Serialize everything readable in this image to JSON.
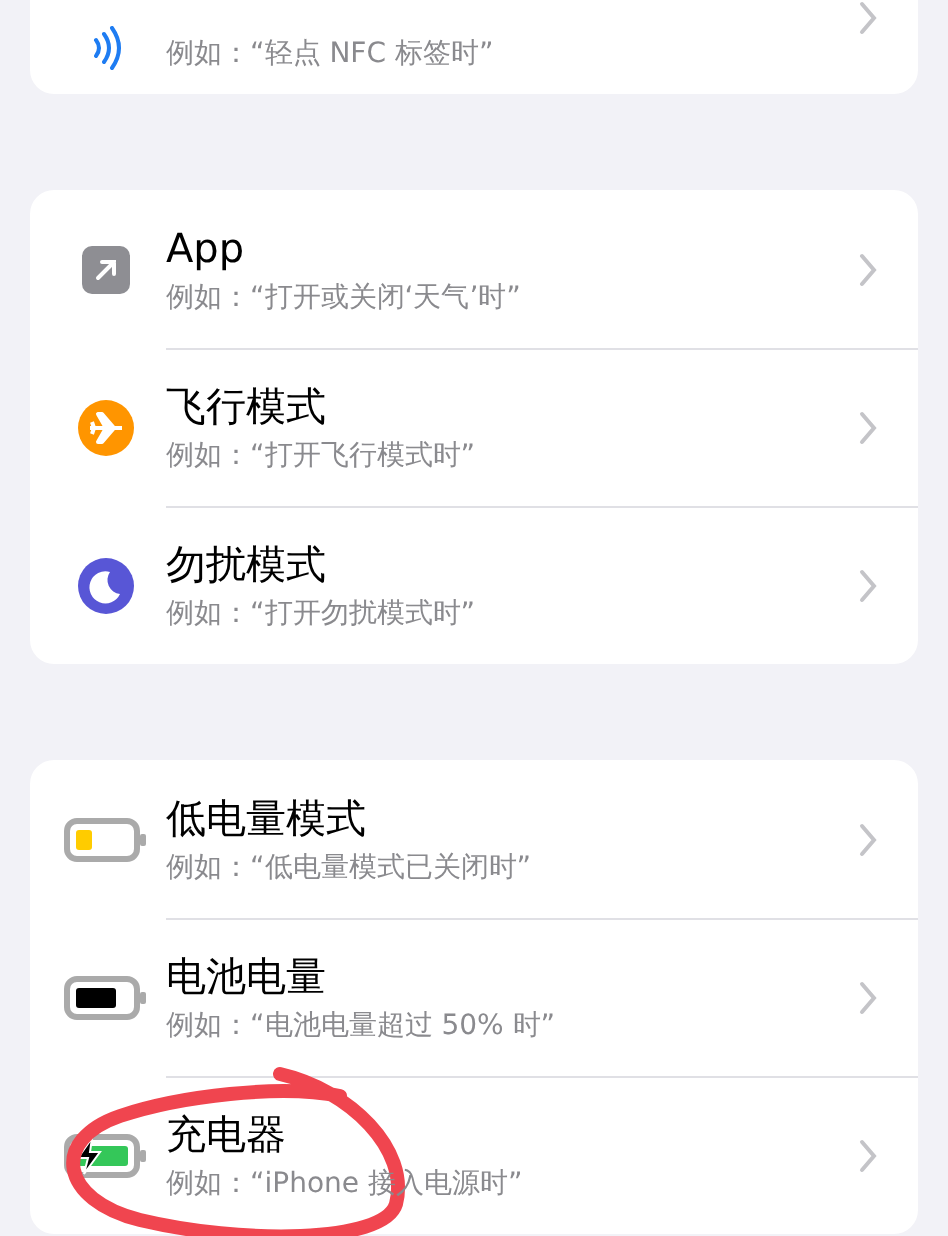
{
  "groups": [
    {
      "items": [
        {
          "subtitle": "例如：“轻点 NFC 标签时”"
        }
      ]
    },
    {
      "items": [
        {
          "title": "App",
          "subtitle": "例如：“打开或关闭‘天气’时”"
        },
        {
          "title": "飞行模式",
          "subtitle": "例如：“打开飞行模式时”"
        },
        {
          "title": "勿扰模式",
          "subtitle": "例如：“打开勿扰模式时”"
        }
      ]
    },
    {
      "items": [
        {
          "title": "低电量模式",
          "subtitle": "例如：“低电量模式已关闭时”"
        },
        {
          "title": "电池电量",
          "subtitle": "例如：“电池电量超过 50% 时”"
        },
        {
          "title": "充电器",
          "subtitle": "例如：“iPhone 接入电源时”"
        }
      ]
    }
  ],
  "annotation": {
    "kind": "circle"
  }
}
